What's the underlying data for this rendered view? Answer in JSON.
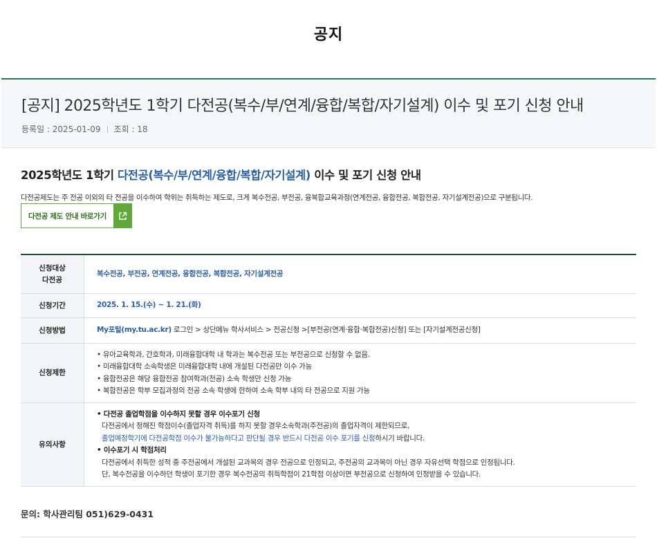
{
  "page": {
    "title": "공지"
  },
  "post": {
    "title": "[공지] 2025학년도 1학기 다전공(복수/부/연계/융합/복합/자기설계) 이수 및 포기 신청 안내",
    "date_label": "등록일 : 2025-01-09",
    "views_label": "조회 : 18"
  },
  "content": {
    "heading_prefix": "2025학년도 1학기 ",
    "heading_highlight": "다전공(복수/부/연계/융합/복합/자기설계)",
    "heading_suffix": " 이수 및 포기 신청 안내",
    "intro": "다전공제도는 주 전공 이외의 타 전공을 이수하여 학위는 취득하는 제도로, 크게 복수전공, 부전공, 융복합교육과정(연계전공, 융합전공, 복합전공, 자기설계전공)으로 구분됩니다.",
    "guide_button": "다전공 제도 안내 바로가기"
  },
  "table": {
    "target_header_1": "신청대상",
    "target_header_2": "다전공",
    "target_value": "복수전공, 부전공, 연계전공, 융합전공, 복합전공, 자기설계전공",
    "period_header": "신청기간",
    "period_value": "2025. 1. 15.(수) ~ 1. 21.(화)",
    "method_header": "신청방법",
    "method_link": "My포털(my.tu.ac.kr)",
    "method_value": " 로그인 > 상단메뉴 학사서비스 > 전공신청 >[부전공(연계·융합·복합전공)신청] 또는 [자기설계전공신청]",
    "limit_header": "신청제한",
    "limit_items": [
      "• 유아교육학과, 간호학과, 미래융합대학 내 학과는 복수전공 또는 부전공으로 신청할 수 없음.",
      "• 미래융합대학 소속학생은 미래융합대학 내에 개설된 다전공만 이수 가능",
      "• 융합전공은 해당 융합전공 참여학과(전공) 소속 학생만 신청 가능",
      "• 복합전공은 학부 모집과정의 전공 소속 학생에 한하여 소속 학부 내의 타 전공으로 지원 가능"
    ],
    "notes_header": "유의사항",
    "notes_1_title": "• 다전공 졸업학점을 이수하지 못할 경우 이수포기 신청",
    "notes_1_line1": "다전공에서 정해진 학점이수(졸업자격 취득)를 하지 못할 경우소속학과(주전공)의 졸업자격이 제한되므로,",
    "notes_1_line2_hl": "졸업예정학기에 다전공학점 이수가 불가능하다고 판단될 경우 반드시 다전공 이수 포기를 신청",
    "notes_1_line2_rest": "하시기 바랍니다.",
    "notes_2_title": "• 이수포기 시 학점처리",
    "notes_2_line1": "다전공에서 취득한 성적 중 주전공에서 개설된 교과목의 경우 전공으로 인정되고, 주전공의 교과목이 아닌 경우 자유선택 학점으로 인정됩니다.",
    "notes_2_line2": "단, 복수전공을 이수하던 학생이 포기한 경우 복수전공의 취득학점이 21학점 이상이면 부전공으로 신청하여 인정받을 수 있습니다."
  },
  "contact": "문의: 학사관리팀 051)629-0431",
  "colors": {
    "accent_green": "#5fa83a",
    "header_line": "#1f7a4f",
    "link_blue": "#2a5fa6"
  },
  "icons": {
    "guide_button_icon": "external-link-icon"
  }
}
